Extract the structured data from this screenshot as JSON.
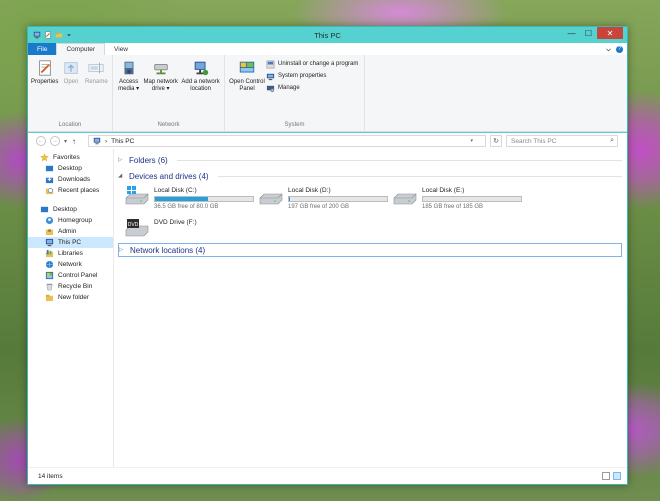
{
  "window": {
    "title": "This PC",
    "controls": {
      "minimize": "—",
      "maximize": "☐",
      "close": "✕"
    }
  },
  "ribbon": {
    "tabs": [
      {
        "label": "File"
      },
      {
        "label": "Computer"
      },
      {
        "label": "View"
      }
    ],
    "groups": {
      "location": {
        "label": "Location",
        "buttons": [
          {
            "label": "Properties"
          },
          {
            "label": "Open"
          },
          {
            "label": "Rename"
          }
        ]
      },
      "network": {
        "label": "Network",
        "access_media": {
          "line1": "Access",
          "line2": "media ▾"
        },
        "map_drive": {
          "line1": "Map network",
          "line2": "drive ▾"
        },
        "add_location": {
          "line1": "Add a network",
          "line2": "location"
        }
      },
      "system": {
        "label": "System",
        "control_panel": {
          "line1": "Open Control",
          "line2": "Panel"
        },
        "small": [
          {
            "label": "Uninstall or change a program"
          },
          {
            "label": "System properties"
          },
          {
            "label": "Manage"
          }
        ]
      }
    }
  },
  "navbar": {
    "back": "←",
    "forward": "→",
    "recent": "▾",
    "up": "↑",
    "address": "This PC",
    "address_separator": "›",
    "address_dropdown": "▾",
    "refresh": "↻",
    "search_placeholder": "Search This PC",
    "search_icon": "⌕"
  },
  "nav_pane": {
    "favorites": {
      "label": "Favorites",
      "items": [
        {
          "label": "Desktop"
        },
        {
          "label": "Downloads"
        },
        {
          "label": "Recent places"
        }
      ]
    },
    "desktop": {
      "label": "Desktop",
      "items": [
        {
          "label": "Homegroup"
        },
        {
          "label": "Admin"
        },
        {
          "label": "This PC"
        },
        {
          "label": "Libraries"
        },
        {
          "label": "Network"
        },
        {
          "label": "Control Panel"
        },
        {
          "label": "Recycle Bin"
        },
        {
          "label": "New folder"
        }
      ]
    }
  },
  "content": {
    "folders": {
      "label": "Folders (6)",
      "arrow": "▷"
    },
    "devices": {
      "label": "Devices and drives (4)",
      "arrow": "◢",
      "drives": [
        {
          "name": "Local Disk (C:)",
          "free": "36.5 GB free of 80.0 GB",
          "used_fraction": 0.54,
          "icon": "windows-drive-icon"
        },
        {
          "name": "Local Disk (D:)",
          "free": "197 GB free of 200 GB",
          "used_fraction": 0.015,
          "icon": "hard-drive-icon"
        },
        {
          "name": "Local Disk (E:)",
          "free": "185 GB free of 185 GB",
          "used_fraction": 0.0,
          "icon": "hard-drive-icon"
        },
        {
          "name": "DVD Drive (F:)",
          "icon": "dvd-drive-icon"
        }
      ]
    },
    "network_locations": {
      "label": "Network locations (4)",
      "arrow": "▷"
    }
  },
  "status": {
    "items_count": "14 items"
  },
  "colors": {
    "accent": "#1979ca",
    "window_frame": "#55d1cf",
    "drive_bar_fill": "#26a0da",
    "section_text": "#1e3287",
    "selected_bg": "#cce8ff"
  }
}
